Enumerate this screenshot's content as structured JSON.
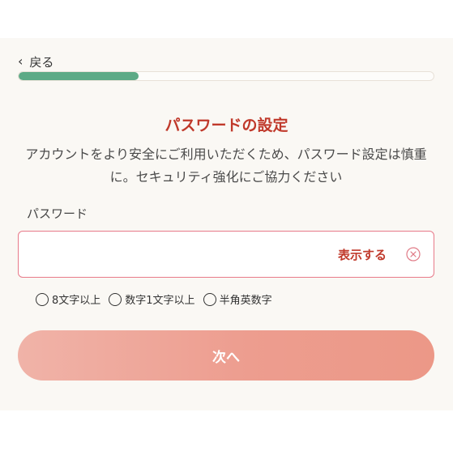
{
  "header": {
    "back_label": "戻る"
  },
  "progress": {
    "value": 0.29
  },
  "main": {
    "title": "パスワードの設定",
    "description": "アカウントをより安全にご利用いただくため、パスワード設定は慎重に。セキュリティ強化にご協力ください",
    "password_label": "パスワード",
    "password_value": "",
    "password_placeholder": "",
    "show_label": "表示する",
    "rules": [
      "8文字以上",
      "数字1文字以上",
      "半角英数字"
    ],
    "next_label": "次へ"
  },
  "colors": {
    "accent": "#c0392b",
    "progress_fill": "#5daa86",
    "button_gradient_start": "#f0b3a8",
    "button_gradient_end": "#ec9887",
    "input_border": "#e87a8a"
  }
}
